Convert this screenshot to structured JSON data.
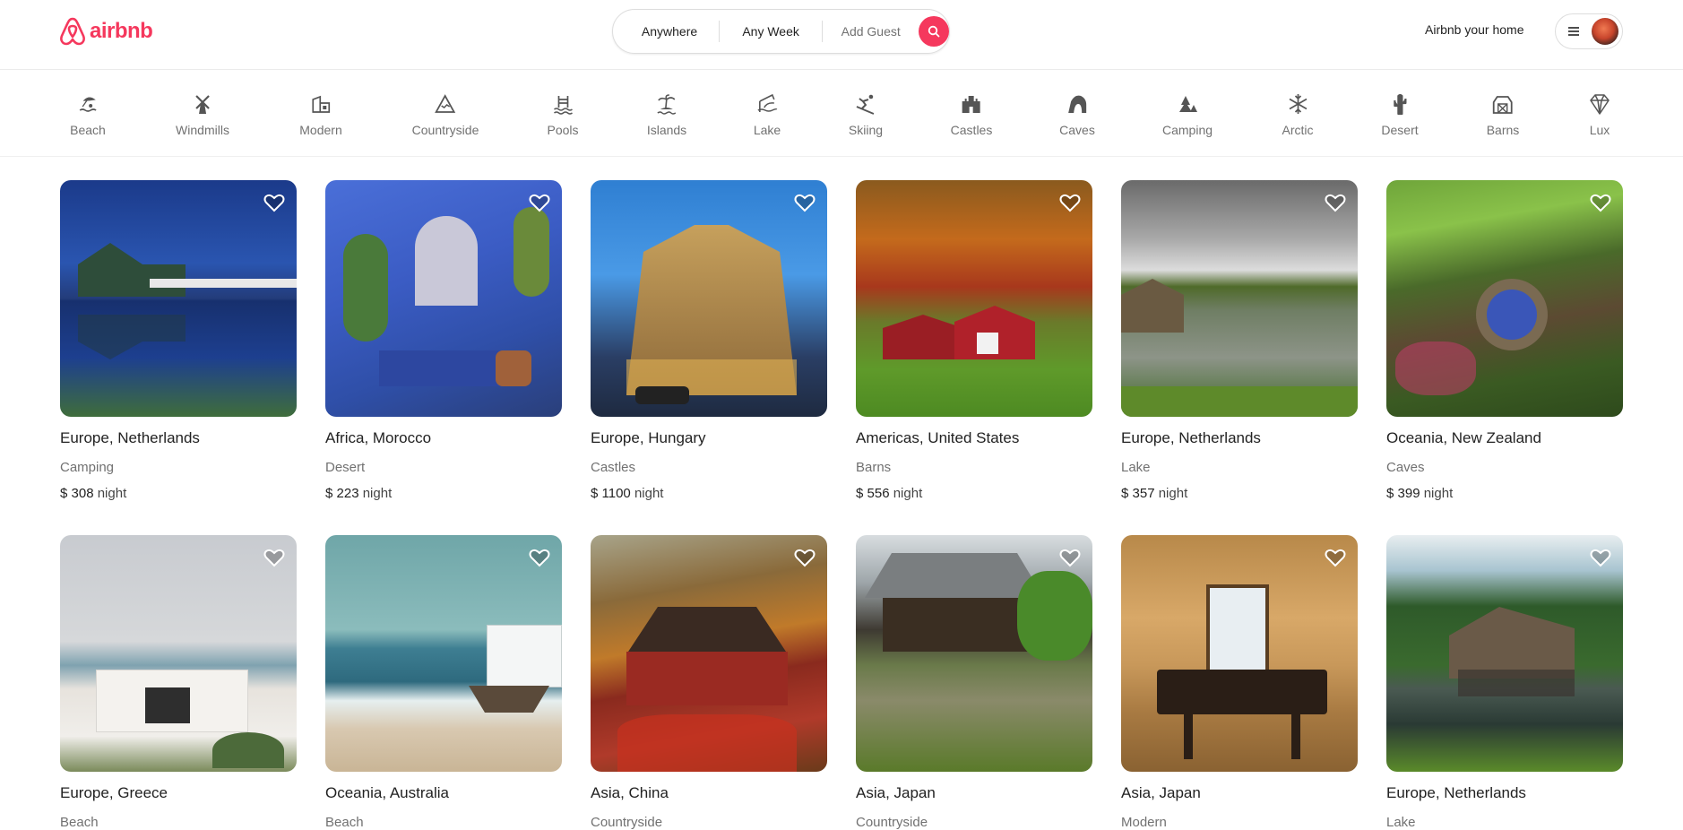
{
  "brand": {
    "name": "airbnb",
    "color": "#F5385D"
  },
  "search": {
    "where": "Anywhere",
    "when": "Any Week",
    "guests": "Add Guest",
    "icon": "search-icon"
  },
  "header": {
    "host_link": "Airbnb your home",
    "menu_icon": "hamburger-icon",
    "avatar": "user-avatar"
  },
  "categories": [
    {
      "label": "Beach",
      "icon": "beach-icon"
    },
    {
      "label": "Windmills",
      "icon": "windmill-icon"
    },
    {
      "label": "Modern",
      "icon": "modern-house-icon"
    },
    {
      "label": "Countryside",
      "icon": "mountain-icon"
    },
    {
      "label": "Pools",
      "icon": "pool-icon"
    },
    {
      "label": "Islands",
      "icon": "island-icon"
    },
    {
      "label": "Lake",
      "icon": "lake-icon"
    },
    {
      "label": "Skiing",
      "icon": "skiing-icon"
    },
    {
      "label": "Castles",
      "icon": "castle-icon"
    },
    {
      "label": "Caves",
      "icon": "cave-icon"
    },
    {
      "label": "Camping",
      "icon": "camping-icon"
    },
    {
      "label": "Arctic",
      "icon": "snowflake-icon"
    },
    {
      "label": "Desert",
      "icon": "cactus-icon"
    },
    {
      "label": "Barns",
      "icon": "barn-icon"
    },
    {
      "label": "Lux",
      "icon": "diamond-icon"
    }
  ],
  "listings": [
    {
      "location": "Europe, Netherlands",
      "category": "Camping",
      "price": "$ 308",
      "unit": "night"
    },
    {
      "location": "Africa, Morocco",
      "category": "Desert",
      "price": "$ 223",
      "unit": "night"
    },
    {
      "location": "Europe, Hungary",
      "category": "Castles",
      "price": "$ 1100",
      "unit": "night"
    },
    {
      "location": "Americas, United States",
      "category": "Barns",
      "price": "$ 556",
      "unit": "night"
    },
    {
      "location": "Europe, Netherlands",
      "category": "Lake",
      "price": "$ 357",
      "unit": "night"
    },
    {
      "location": "Oceania, New Zealand",
      "category": "Caves",
      "price": "$ 399",
      "unit": "night"
    },
    {
      "location": "Europe, Greece",
      "category": "Beach"
    },
    {
      "location": "Oceania, Australia",
      "category": "Beach"
    },
    {
      "location": "Asia, China",
      "category": "Countryside"
    },
    {
      "location": "Asia, Japan",
      "category": "Countryside"
    },
    {
      "location": "Asia, Japan",
      "category": "Modern"
    },
    {
      "location": "Europe, Netherlands",
      "category": "Lake"
    }
  ]
}
